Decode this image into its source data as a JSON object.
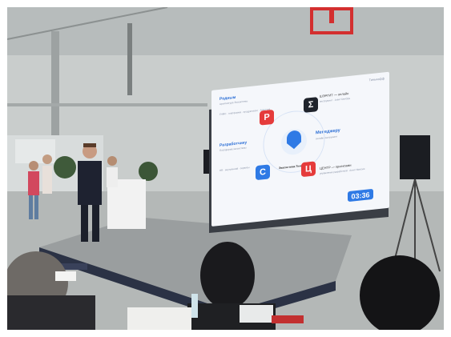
{
  "photo": {
    "description_colors": {
      "ceiling": "#c7cbca",
      "floor": "#b8bcbc",
      "screen_bg": "#f5f7fb",
      "accent_blue": "#2f7ae5",
      "accent_red": "#e53b3b"
    }
  },
  "screen": {
    "brand": "Тинькофф",
    "left_top_title": "Родным",
    "left_top_sub": "Архитектура Экосистемы",
    "left_top_lines": "ГНМС · платформа · продуктового · Агентура",
    "left_mid_title": "Разработчику",
    "left_mid_sub": "Платформа экосистемы",
    "left_bot_lines": "HR · внутренний · сервисы",
    "right_top_title": "ШЭРГИТ — онлайн",
    "right_top_lines": "инструмент · Агент DevOps",
    "right_mid_title": "Менеджеру",
    "right_mid_sub": "онлайн-инструмент",
    "right_bot_title": "ЦЕНТР — проектами",
    "right_bot_lines": "управление разработкой · Агент Миссия",
    "center_label": "Экосистема Тинькофф",
    "timer": "03:36"
  },
  "icons": {
    "top_left": "Р",
    "mid_left": "С",
    "top_right": "Σ",
    "bot_right": "Ц"
  }
}
